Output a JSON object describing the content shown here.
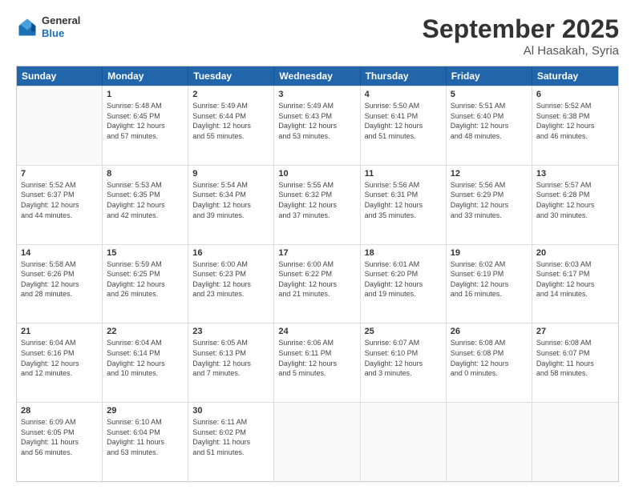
{
  "header": {
    "logo_general": "General",
    "logo_blue": "Blue",
    "month": "September 2025",
    "location": "Al Hasakah, Syria"
  },
  "days_of_week": [
    "Sunday",
    "Monday",
    "Tuesday",
    "Wednesday",
    "Thursday",
    "Friday",
    "Saturday"
  ],
  "weeks": [
    [
      {
        "day": "",
        "info": ""
      },
      {
        "day": "1",
        "info": "Sunrise: 5:48 AM\nSunset: 6:45 PM\nDaylight: 12 hours\nand 57 minutes."
      },
      {
        "day": "2",
        "info": "Sunrise: 5:49 AM\nSunset: 6:44 PM\nDaylight: 12 hours\nand 55 minutes."
      },
      {
        "day": "3",
        "info": "Sunrise: 5:49 AM\nSunset: 6:43 PM\nDaylight: 12 hours\nand 53 minutes."
      },
      {
        "day": "4",
        "info": "Sunrise: 5:50 AM\nSunset: 6:41 PM\nDaylight: 12 hours\nand 51 minutes."
      },
      {
        "day": "5",
        "info": "Sunrise: 5:51 AM\nSunset: 6:40 PM\nDaylight: 12 hours\nand 48 minutes."
      },
      {
        "day": "6",
        "info": "Sunrise: 5:52 AM\nSunset: 6:38 PM\nDaylight: 12 hours\nand 46 minutes."
      }
    ],
    [
      {
        "day": "7",
        "info": "Sunrise: 5:52 AM\nSunset: 6:37 PM\nDaylight: 12 hours\nand 44 minutes."
      },
      {
        "day": "8",
        "info": "Sunrise: 5:53 AM\nSunset: 6:35 PM\nDaylight: 12 hours\nand 42 minutes."
      },
      {
        "day": "9",
        "info": "Sunrise: 5:54 AM\nSunset: 6:34 PM\nDaylight: 12 hours\nand 39 minutes."
      },
      {
        "day": "10",
        "info": "Sunrise: 5:55 AM\nSunset: 6:32 PM\nDaylight: 12 hours\nand 37 minutes."
      },
      {
        "day": "11",
        "info": "Sunrise: 5:56 AM\nSunset: 6:31 PM\nDaylight: 12 hours\nand 35 minutes."
      },
      {
        "day": "12",
        "info": "Sunrise: 5:56 AM\nSunset: 6:29 PM\nDaylight: 12 hours\nand 33 minutes."
      },
      {
        "day": "13",
        "info": "Sunrise: 5:57 AM\nSunset: 6:28 PM\nDaylight: 12 hours\nand 30 minutes."
      }
    ],
    [
      {
        "day": "14",
        "info": "Sunrise: 5:58 AM\nSunset: 6:26 PM\nDaylight: 12 hours\nand 28 minutes."
      },
      {
        "day": "15",
        "info": "Sunrise: 5:59 AM\nSunset: 6:25 PM\nDaylight: 12 hours\nand 26 minutes."
      },
      {
        "day": "16",
        "info": "Sunrise: 6:00 AM\nSunset: 6:23 PM\nDaylight: 12 hours\nand 23 minutes."
      },
      {
        "day": "17",
        "info": "Sunrise: 6:00 AM\nSunset: 6:22 PM\nDaylight: 12 hours\nand 21 minutes."
      },
      {
        "day": "18",
        "info": "Sunrise: 6:01 AM\nSunset: 6:20 PM\nDaylight: 12 hours\nand 19 minutes."
      },
      {
        "day": "19",
        "info": "Sunrise: 6:02 AM\nSunset: 6:19 PM\nDaylight: 12 hours\nand 16 minutes."
      },
      {
        "day": "20",
        "info": "Sunrise: 6:03 AM\nSunset: 6:17 PM\nDaylight: 12 hours\nand 14 minutes."
      }
    ],
    [
      {
        "day": "21",
        "info": "Sunrise: 6:04 AM\nSunset: 6:16 PM\nDaylight: 12 hours\nand 12 minutes."
      },
      {
        "day": "22",
        "info": "Sunrise: 6:04 AM\nSunset: 6:14 PM\nDaylight: 12 hours\nand 10 minutes."
      },
      {
        "day": "23",
        "info": "Sunrise: 6:05 AM\nSunset: 6:13 PM\nDaylight: 12 hours\nand 7 minutes."
      },
      {
        "day": "24",
        "info": "Sunrise: 6:06 AM\nSunset: 6:11 PM\nDaylight: 12 hours\nand 5 minutes."
      },
      {
        "day": "25",
        "info": "Sunrise: 6:07 AM\nSunset: 6:10 PM\nDaylight: 12 hours\nand 3 minutes."
      },
      {
        "day": "26",
        "info": "Sunrise: 6:08 AM\nSunset: 6:08 PM\nDaylight: 12 hours\nand 0 minutes."
      },
      {
        "day": "27",
        "info": "Sunrise: 6:08 AM\nSunset: 6:07 PM\nDaylight: 11 hours\nand 58 minutes."
      }
    ],
    [
      {
        "day": "28",
        "info": "Sunrise: 6:09 AM\nSunset: 6:05 PM\nDaylight: 11 hours\nand 56 minutes."
      },
      {
        "day": "29",
        "info": "Sunrise: 6:10 AM\nSunset: 6:04 PM\nDaylight: 11 hours\nand 53 minutes."
      },
      {
        "day": "30",
        "info": "Sunrise: 6:11 AM\nSunset: 6:02 PM\nDaylight: 11 hours\nand 51 minutes."
      },
      {
        "day": "",
        "info": ""
      },
      {
        "day": "",
        "info": ""
      },
      {
        "day": "",
        "info": ""
      },
      {
        "day": "",
        "info": ""
      }
    ]
  ]
}
